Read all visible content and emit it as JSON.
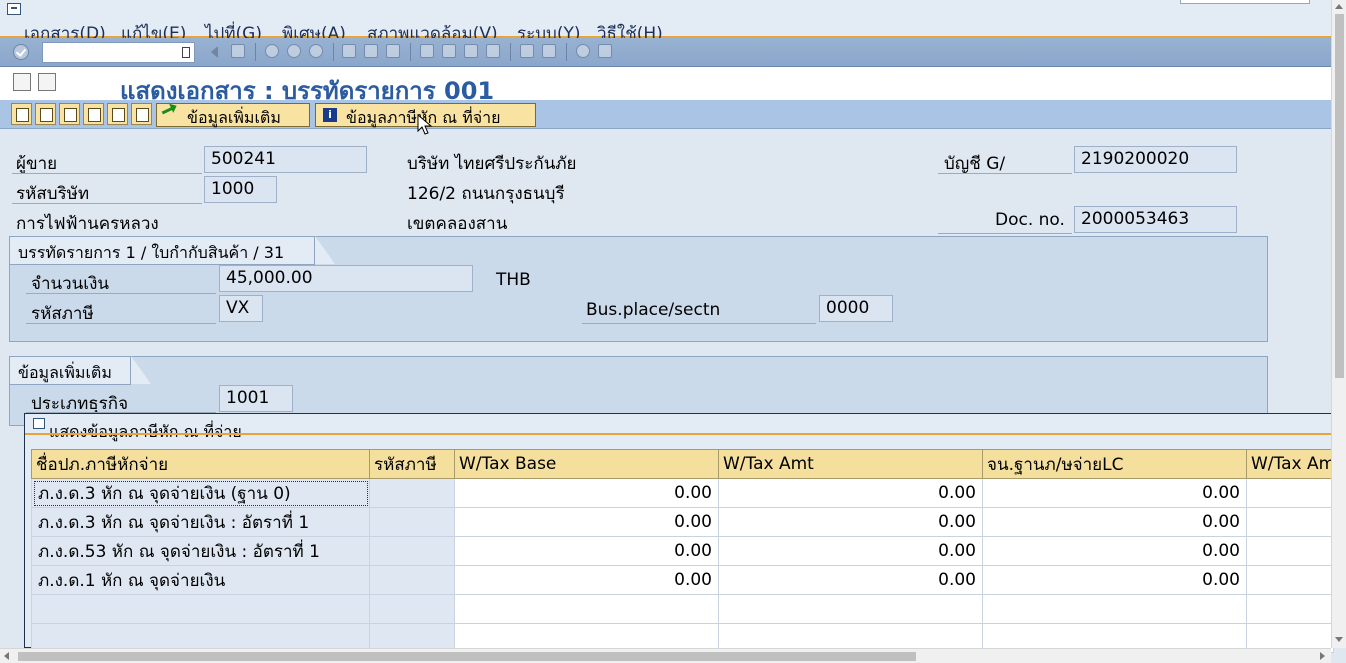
{
  "menu": {
    "items": [
      "เอกสาร(D)",
      "แก้ไข(E)",
      "ไปที่(G)",
      "พิเศษ(A)",
      "สภาพแวดล้อม(V)",
      "ระบบ(Y)",
      "วิธีใช้(H)"
    ]
  },
  "system_toolbar": {
    "command_field_value": ""
  },
  "title": {
    "text": "แสดงเอกสาร : บรรทัดรายการ 001"
  },
  "app_toolbar": {
    "additional_data_label": "ข้อมูลเพิ่มเติม",
    "withholding_tax_label": "ข้อมูลภาษีหัก ณ ที่จ่าย"
  },
  "header": {
    "vendor_label": "ผู้ขาย",
    "vendor_value": "500241",
    "company_code_label": "รหัสบริษัท",
    "company_code_value": "1000",
    "vendor_name": "การไฟฟ้านครหลวง",
    "company_name": "บริษัท ไทยศรีประกันภัย",
    "address_line1": "126/2 ถนนกรุงธนบุรี",
    "address_line2": "เขตคลองสาน",
    "gl_account_label": "บัญชี G/",
    "gl_account_value": "2190200020",
    "doc_no_label": "Doc. no.",
    "doc_no_value": "2000053463"
  },
  "line_item_group": {
    "title": "บรรทัดรายการ 1 / ใบกำกับสินค้า / 31",
    "amount_label": "จำนวนเงิน",
    "amount_value": "45,000.00",
    "currency": "THB",
    "tax_code_label": "รหัสภาษี",
    "tax_code_value": "VX",
    "bus_place_label": "Bus.place/sectn",
    "bus_place_value": "0000"
  },
  "additional_group": {
    "title": "ข้อมูลเพิ่มเติม",
    "business_area_label": "ประเภทธุรกิจ",
    "business_area_value": "1001"
  },
  "wht_popup": {
    "title": "แสดงข้อมูลภาษีหัก ณ ที่จ่าย",
    "columns": [
      "ชื่อปภ.ภาษีหักจ่าย",
      "รหัสภาษี",
      "W/Tax Base",
      "W/Tax Amt",
      "จน.ฐานภ/ษจ่ายLC",
      "W/Tax Am"
    ],
    "rows": [
      {
        "name": "ภ.ง.ด.3 หัก ณ จุดจ่ายเงิน (ฐาน 0)",
        "code": "",
        "base": "0.00",
        "amt": "0.00",
        "lc": "0.00"
      },
      {
        "name": "ภ.ง.ด.3 หัก ณ จุดจ่ายเงิน : อัตราที่ 1",
        "code": "",
        "base": "0.00",
        "amt": "0.00",
        "lc": "0.00"
      },
      {
        "name": "ภ.ง.ด.53 หัก ณ จุดจ่ายเงิน : อัตราที่ 1",
        "code": "",
        "base": "0.00",
        "amt": "0.00",
        "lc": "0.00"
      },
      {
        "name": "ภ.ง.ด.1 หัก ณ จุดจ่ายเงิน",
        "code": "",
        "base": "0.00",
        "amt": "0.00",
        "lc": "0.00"
      },
      {
        "name": "",
        "code": "",
        "base": "",
        "amt": "",
        "lc": ""
      },
      {
        "name": "",
        "code": "",
        "base": "",
        "amt": "",
        "lc": ""
      }
    ]
  },
  "colors": {
    "title_blue": "#2b5ba0",
    "accent_orange": "#e8a33a",
    "button_yellow": "#f9e3a2",
    "toolbar_blue": "#a9c4e4",
    "group_blue": "#cbdaeb"
  }
}
